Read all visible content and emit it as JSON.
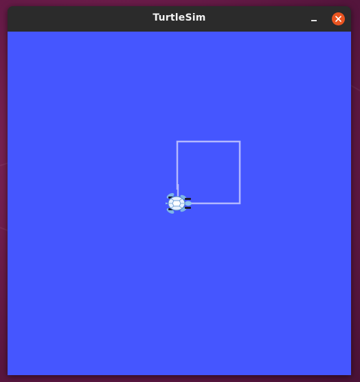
{
  "window": {
    "title": "TurtleSim",
    "background_color": "#4556ff",
    "pen_color": "#b3b8ff"
  },
  "controls": {
    "minimize_icon": "minimize-icon",
    "close_icon": "close-icon",
    "close_color": "#e95420"
  },
  "turtle": {
    "icon": "turtle-icon",
    "heading": "east"
  }
}
